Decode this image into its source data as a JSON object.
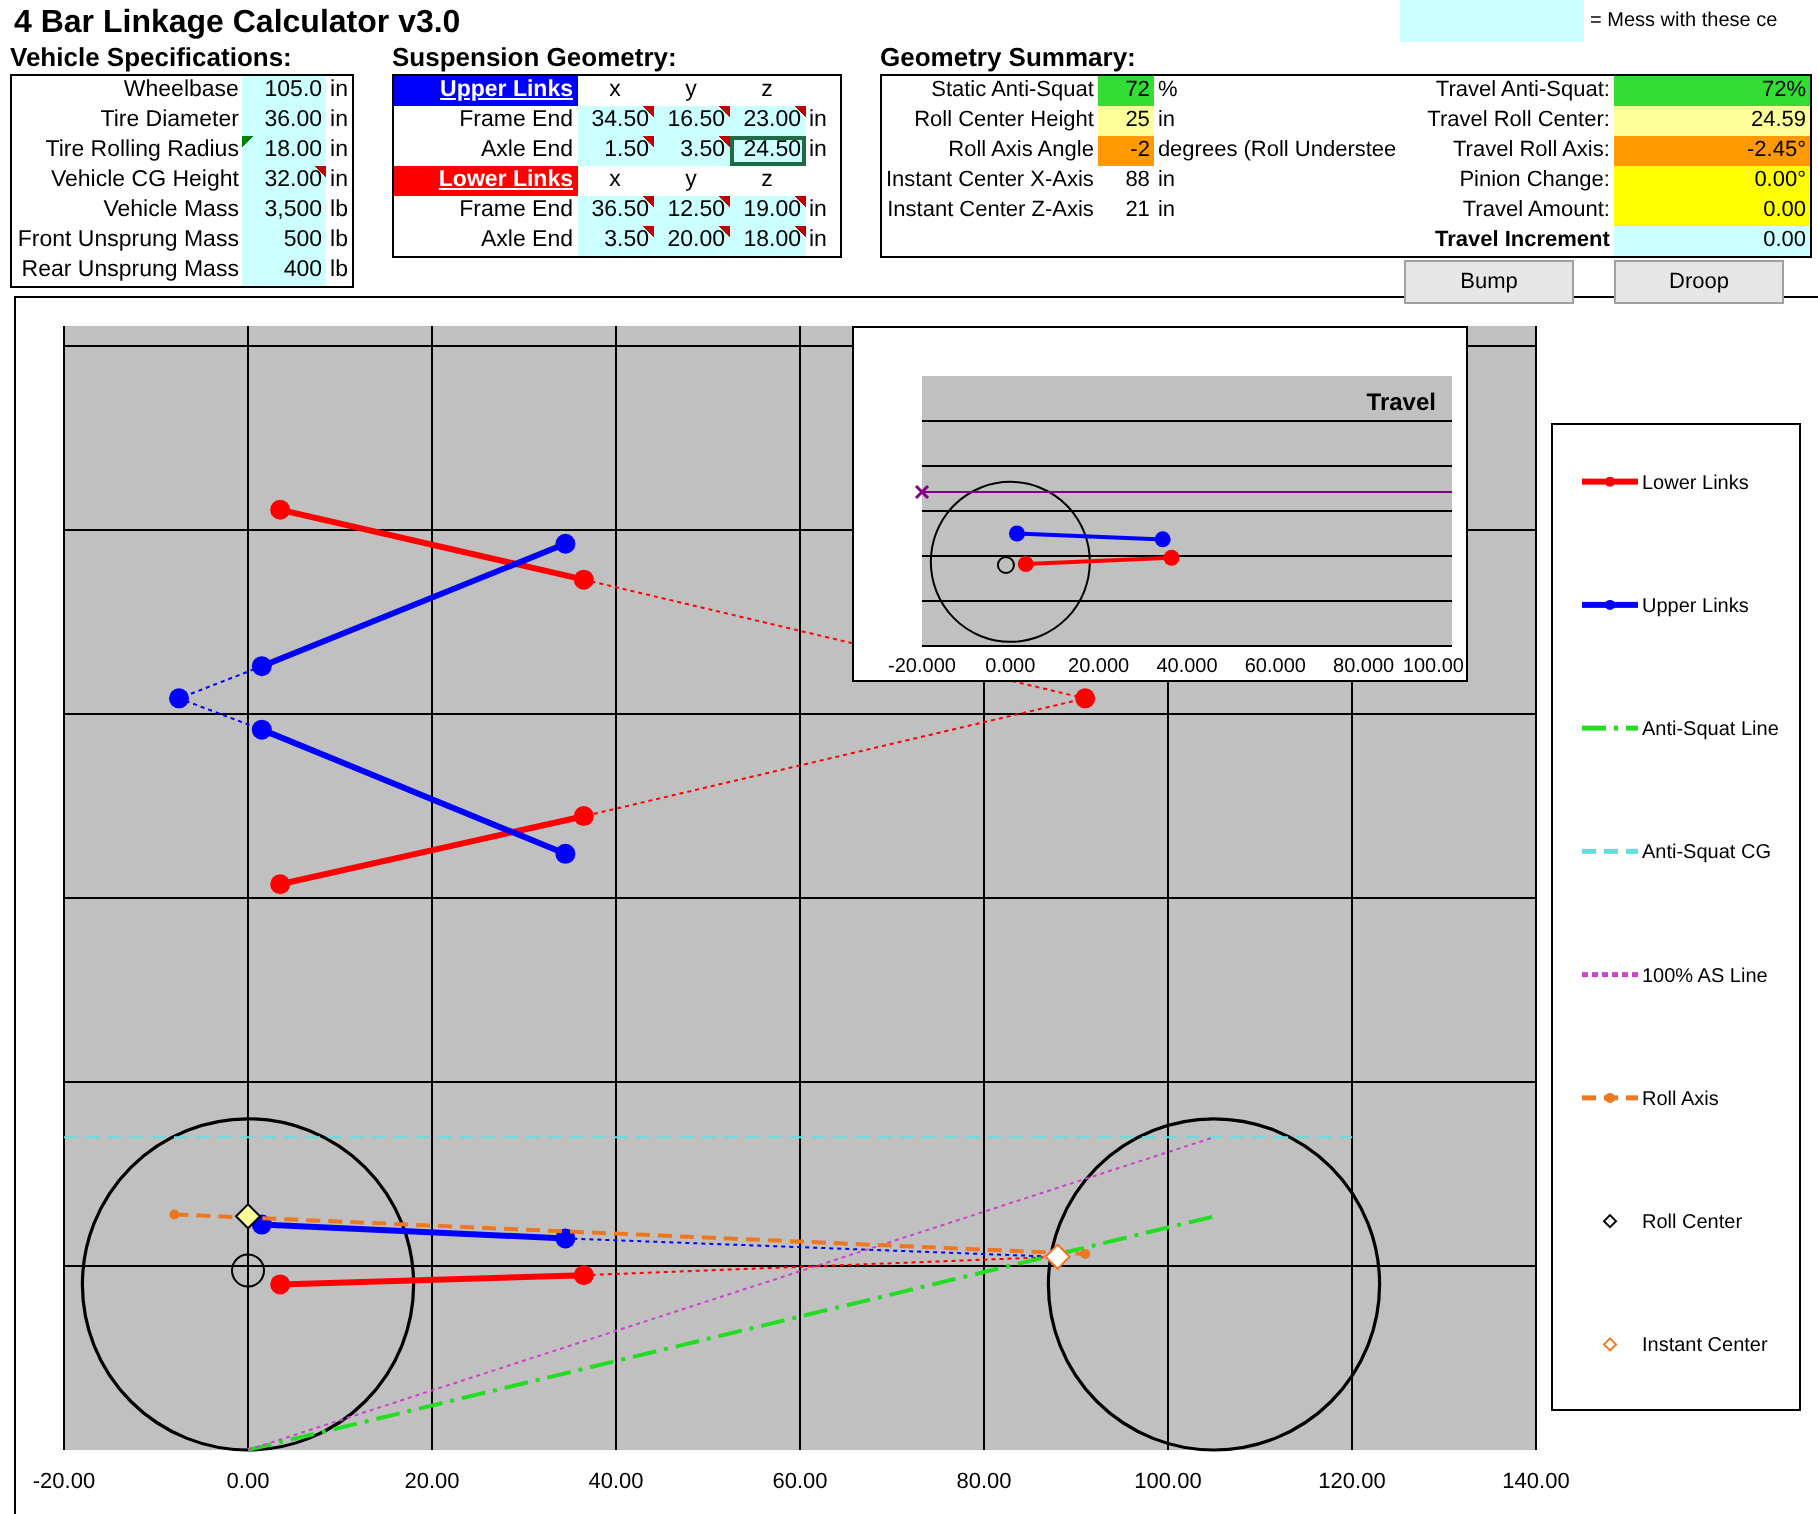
{
  "title": "4 Bar Linkage Calculator v3.0",
  "legend_note": {
    "color": "#ccffff",
    "text": "= Mess with these ce"
  },
  "vehicle_specs": {
    "title": "Vehicle Specifications:",
    "rows": [
      {
        "label": "Wheelbase",
        "value": "105.0",
        "unit": "in",
        "note": false,
        "warning": false
      },
      {
        "label": "Tire Diameter",
        "value": "36.00",
        "unit": "in",
        "note": false,
        "warning": false
      },
      {
        "label": "Tire Rolling Radius",
        "value": "18.00",
        "unit": "in",
        "note": false,
        "warning": true
      },
      {
        "label": "Vehicle CG Height",
        "value": "32.00",
        "unit": "in",
        "note": true,
        "warning": false
      },
      {
        "label": "Vehicle Mass",
        "value": "3,500",
        "unit": "lb",
        "note": false,
        "warning": false
      },
      {
        "label": "Front Unsprung Mass",
        "value": "500",
        "unit": "lb",
        "note": false,
        "warning": false
      },
      {
        "label": "Rear Unsprung Mass",
        "value": "400",
        "unit": "lb",
        "note": false,
        "warning": false
      }
    ]
  },
  "suspension": {
    "title": "Suspension Geometry:",
    "groups": [
      {
        "label": "Upper Links",
        "color": "#0000ff",
        "axes": [
          "x",
          "y",
          "z"
        ],
        "rows": [
          {
            "label": "Frame End",
            "unit": "in",
            "cells": [
              {
                "value": "34.50",
                "note": true,
                "selected": false
              },
              {
                "value": "16.50",
                "note": true,
                "selected": false
              },
              {
                "value": "23.00",
                "note": true,
                "selected": false
              }
            ]
          },
          {
            "label": "Axle End",
            "unit": "in",
            "cells": [
              {
                "value": "1.50",
                "note": true,
                "selected": false
              },
              {
                "value": "3.50",
                "note": true,
                "selected": false
              },
              {
                "value": "24.50",
                "note": false,
                "selected": true
              }
            ]
          }
        ]
      },
      {
        "label": "Lower Links",
        "color": "#ff0000",
        "axes": [
          "x",
          "y",
          "z"
        ],
        "rows": [
          {
            "label": "Frame End",
            "unit": "in",
            "cells": [
              {
                "value": "36.50",
                "note": true,
                "selected": false
              },
              {
                "value": "12.50",
                "note": true,
                "selected": false
              },
              {
                "value": "19.00",
                "note": true,
                "selected": false
              }
            ]
          },
          {
            "label": "Axle End",
            "unit": "in",
            "cells": [
              {
                "value": "3.50",
                "note": true,
                "selected": false
              },
              {
                "value": "20.00",
                "note": true,
                "selected": false
              },
              {
                "value": "18.00",
                "note": true,
                "selected": false
              }
            ]
          }
        ]
      }
    ]
  },
  "summary": {
    "title": "Geometry Summary:",
    "left": [
      {
        "label": "Static Anti-Squat",
        "value": "72",
        "unit": "%",
        "color": "#33dd33"
      },
      {
        "label": "Roll Center Height",
        "value": "25",
        "unit": "in",
        "color": "#ffff99"
      },
      {
        "label": "Roll Axis Angle",
        "value": "-2",
        "unit": "degrees (Roll Understee",
        "color": "#ff9900"
      },
      {
        "label": "Instant Center X-Axis",
        "value": "88",
        "unit": "in"
      },
      {
        "label": "Instant Center Z-Axis",
        "value": "21",
        "unit": "in"
      }
    ],
    "right": [
      {
        "label": "Travel Anti-Squat:",
        "value": "72%",
        "color": "#33dd33",
        "kind": "output"
      },
      {
        "label": "Travel Roll Center:",
        "value": "24.59",
        "color": "#ffff99",
        "kind": "output"
      },
      {
        "label": "Travel Roll Axis:",
        "value": "-2.45°",
        "color": "#ff9900",
        "kind": "output"
      },
      {
        "label": "Pinion Change:",
        "value": "0.00°",
        "color": "#ffff00",
        "kind": "output"
      },
      {
        "label": "Travel Amount:",
        "value": "0.00",
        "color": "#ffff00",
        "kind": "output"
      },
      {
        "label": "Travel Increment",
        "value": "0.00",
        "color": "#ccffff",
        "kind": "input"
      }
    ]
  },
  "buttons": [
    "Bump",
    "Droop"
  ],
  "chart": {
    "x_axis_labels": [
      "-20.00",
      "0.00",
      "20.00",
      "40.00",
      "60.00",
      "80.00",
      "100.00",
      "120.00",
      "140.00"
    ],
    "legend": [
      {
        "name": "Lower Links",
        "color": "#ff0000",
        "kind": "solid"
      },
      {
        "name": "Upper Links",
        "color": "#0000ff",
        "kind": "solid"
      },
      {
        "name": "Anti-Squat Line",
        "color": "#22dd22",
        "kind": "dashdot"
      },
      {
        "name": "Anti-Squat CG",
        "color": "#66dddd",
        "kind": "dashed"
      },
      {
        "name": "100% AS Line",
        "color": "#cc44cc",
        "kind": "dotted"
      },
      {
        "name": "Roll Axis",
        "color": "#ee7722",
        "kind": "dashmarker"
      },
      {
        "name": "Roll Center",
        "color": "#000000",
        "kind": "point"
      },
      {
        "name": "Instant Center",
        "color": "#ee7722",
        "kind": "point"
      }
    ]
  },
  "inset": {
    "title": "Travel",
    "x_axis_labels": [
      "-20.000",
      "0.000",
      "20.000",
      "40.000",
      "60.000",
      "80.000",
      "100.00"
    ]
  }
}
